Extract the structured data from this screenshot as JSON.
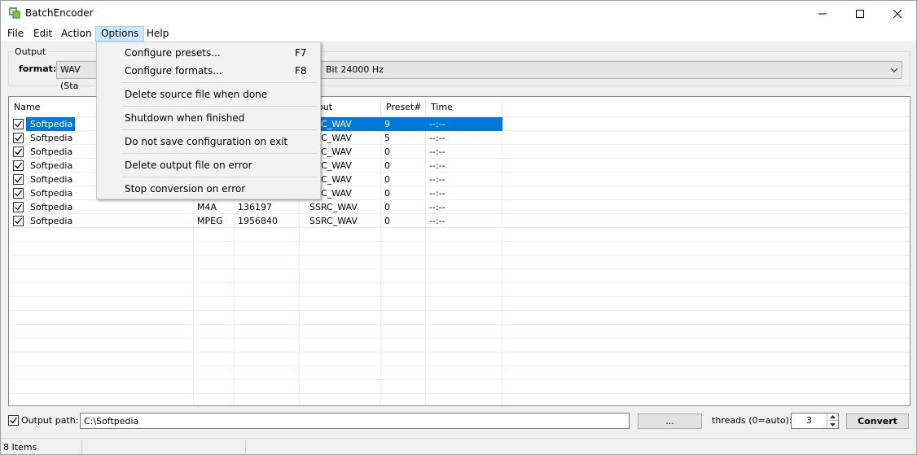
{
  "window": {
    "title": "BatchEncoder",
    "accent_color": "#0078d7"
  },
  "menu": {
    "items": [
      "File",
      "Edit",
      "Action",
      "Options",
      "Help"
    ],
    "active": "Options"
  },
  "output": {
    "group_label": "Output",
    "format_label": "format:",
    "format_value": "WAV (Sta",
    "preset_value": "Bit 24000 Hz"
  },
  "list": {
    "columns": {
      "name": "Name",
      "output": "out",
      "preset": "Preset#",
      "time": "Time"
    },
    "rows": [
      {
        "name": "Softpedia",
        "type": "",
        "size": "",
        "output": "SRC_WAV",
        "preset": "9",
        "time": "--:--",
        "checked": true,
        "selected": true
      },
      {
        "name": "Softpedia",
        "type": "",
        "size": "",
        "output": "SRC_WAV",
        "preset": "5",
        "time": "--:--",
        "checked": true,
        "selected": false
      },
      {
        "name": "Softpedia",
        "type": "",
        "size": "",
        "output": "SRC_WAV",
        "preset": "0",
        "time": "--:--",
        "checked": true,
        "selected": false
      },
      {
        "name": "Softpedia",
        "type": "",
        "size": "",
        "output": "SRC_WAV",
        "preset": "0",
        "time": "--:--",
        "checked": true,
        "selected": false
      },
      {
        "name": "Softpedia",
        "type": "",
        "size": "",
        "output": "SRC_WAV",
        "preset": "0",
        "time": "--:--",
        "checked": true,
        "selected": false
      },
      {
        "name": "Softpedia",
        "type": "",
        "size": "",
        "output": "SRC_WAV",
        "preset": "0",
        "time": "--:--",
        "checked": true,
        "selected": false
      },
      {
        "name": "Softpedia",
        "type": "M4A",
        "size": "136197",
        "output": "SSRC_WAV",
        "preset": "0",
        "time": "--:--",
        "checked": true,
        "selected": false
      },
      {
        "name": "Softpedia",
        "type": "MPEG",
        "size": "1956840",
        "output": "SSRC_WAV",
        "preset": "0",
        "time": "--:--",
        "checked": true,
        "selected": false
      }
    ]
  },
  "options_menu": {
    "items": [
      {
        "label": "Configure presets...",
        "shortcut": "F7"
      },
      {
        "label": "Configure formats...",
        "shortcut": "F8"
      },
      {
        "label": "Delete source file when done",
        "shortcut": ""
      },
      {
        "label": "Shutdown when finished",
        "shortcut": ""
      },
      {
        "label": "Do not save configuration on exit",
        "shortcut": ""
      },
      {
        "label": "Delete output file on error",
        "shortcut": ""
      },
      {
        "label": "Stop conversion on error",
        "shortcut": ""
      }
    ]
  },
  "bottom": {
    "output_path_label": "Output path:",
    "output_path_checked": true,
    "output_path_value": "C:\\Softpedia",
    "browse_label": "...",
    "threads_label": "threads (0=auto):",
    "threads_value": "3",
    "convert_label": "Convert"
  },
  "status": {
    "text": "8 Items"
  }
}
